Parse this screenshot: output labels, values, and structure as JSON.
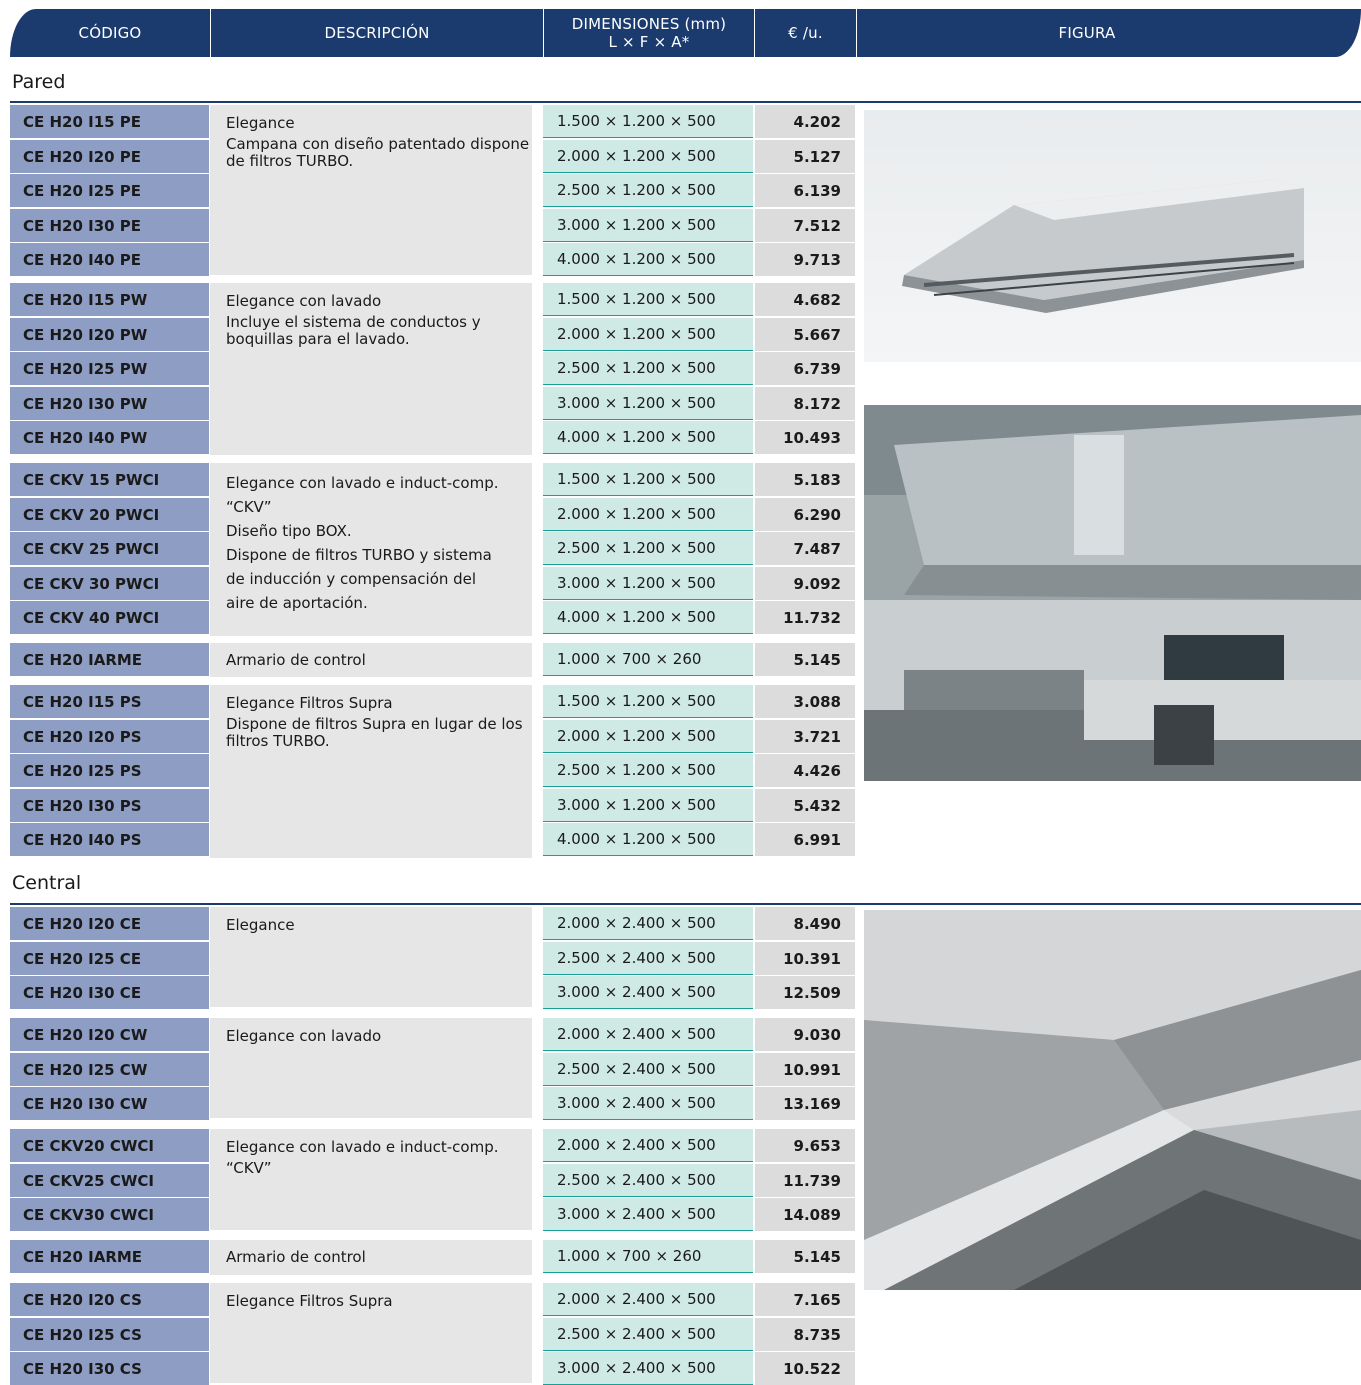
{
  "header": {
    "cols": [
      "CÓDIGO",
      "DESCRIPCIÓN",
      "DIMENSIONES (mm)",
      "€ /u.",
      "FIGURA"
    ],
    "dim_sub": "L × F × A*"
  },
  "sections": {
    "pared": {
      "title": "Pared",
      "groups": [
        {
          "name": "Elegance",
          "note": "Campana con diseño patentado dispone de filtros TURBO.",
          "rows": [
            {
              "code": "CE H20 I15 PE",
              "dim": "1.500 × 1.200 × 500",
              "price": "4.202"
            },
            {
              "code": "CE H20 I20 PE",
              "dim": "2.000 × 1.200 × 500",
              "price": "5.127"
            },
            {
              "code": "CE H20 I25 PE",
              "dim": "2.500 × 1.200 × 500",
              "price": "6.139"
            },
            {
              "code": "CE H20 I30 PE",
              "dim": "3.000 × 1.200 × 500",
              "price": "7.512"
            },
            {
              "code": "CE H20 I40 PE",
              "dim": "4.000 × 1.200 × 500",
              "price": "9.713"
            }
          ]
        },
        {
          "name": "Elegance con lavado",
          "note": "Incluye el sistema de conductos y boquillas para el lavado.",
          "rows": [
            {
              "code": "CE H20 I15 PW",
              "dim": "1.500 × 1.200 × 500",
              "price": "4.682"
            },
            {
              "code": "CE H20 I20 PW",
              "dim": "2.000 × 1.200 × 500",
              "price": "5.667"
            },
            {
              "code": "CE H20 I25 PW",
              "dim": "2.500 × 1.200 × 500",
              "price": "6.739"
            },
            {
              "code": "CE H20 I30 PW",
              "dim": "3.000 × 1.200 × 500",
              "price": "8.172"
            },
            {
              "code": "CE H20 I40 PW",
              "dim": "4.000 × 1.200 × 500",
              "price": "10.493"
            }
          ]
        },
        {
          "lines": [
            "Elegance con lavado e induct-comp.",
            "“CKV”",
            "Diseño tipo BOX.",
            "Dispone de filtros TURBO y sistema",
            "de inducción y compensación del",
            "aire de aportación."
          ],
          "rows": [
            {
              "code": "CE CKV 15 PWCI",
              "dim": "1.500 × 1.200 × 500",
              "price": "5.183"
            },
            {
              "code": "CE CKV 20 PWCI",
              "dim": "2.000 × 1.200 × 500",
              "price": "6.290"
            },
            {
              "code": "CE CKV 25 PWCI",
              "dim": "2.500 × 1.200 × 500",
              "price": "7.487"
            },
            {
              "code": "CE CKV 30 PWCI",
              "dim": "3.000 × 1.200 × 500",
              "price": "9.092"
            },
            {
              "code": "CE CKV 40 PWCI",
              "dim": "4.000 × 1.200 × 500",
              "price": "11.732"
            }
          ]
        },
        {
          "name": "Armario de control",
          "rows": [
            {
              "code": "CE H20 IARME",
              "dim": "1.000 × 700 × 260",
              "price": "5.145"
            }
          ]
        },
        {
          "name": "Elegance Filtros Supra",
          "note": "Dispone de filtros Supra en lugar de los filtros TURBO.",
          "rows": [
            {
              "code": "CE H20 I15 PS",
              "dim": "1.500 × 1.200 × 500",
              "price": "3.088"
            },
            {
              "code": "CE H20 I20 PS",
              "dim": "2.000 × 1.200 × 500",
              "price": "3.721"
            },
            {
              "code": "CE H20 I25 PS",
              "dim": "2.500 × 1.200 × 500",
              "price": "4.426"
            },
            {
              "code": "CE H20 I30 PS",
              "dim": "3.000 × 1.200 × 500",
              "price": "5.432"
            },
            {
              "code": "CE H20 I40 PS",
              "dim": "4.000 × 1.200 × 500",
              "price": "6.991"
            }
          ]
        }
      ]
    },
    "central": {
      "title": "Central",
      "groups": [
        {
          "name": "Elegance",
          "rows": [
            {
              "code": "CE H20 I20 CE",
              "dim": "2.000 × 2.400 × 500",
              "price": "8.490"
            },
            {
              "code": "CE H20 I25 CE",
              "dim": "2.500 × 2.400 × 500",
              "price": "10.391"
            },
            {
              "code": "CE H20 I30 CE",
              "dim": "3.000 × 2.400 × 500",
              "price": "12.509"
            }
          ]
        },
        {
          "name": "Elegance con lavado",
          "rows": [
            {
              "code": "CE H20 I20 CW",
              "dim": "2.000 × 2.400 × 500",
              "price": "9.030"
            },
            {
              "code": "CE H20 I25 CW",
              "dim": "2.500 × 2.400 × 500",
              "price": "10.991"
            },
            {
              "code": "CE H20 I30 CW",
              "dim": "3.000 × 2.400 × 500",
              "price": "13.169"
            }
          ]
        },
        {
          "name": "Elegance con lavado e induct-comp.",
          "note": "“CKV”",
          "rows": [
            {
              "code": "CE CKV20 CWCI",
              "dim": "2.000 × 2.400 × 500",
              "price": "9.653"
            },
            {
              "code": "CE CKV25 CWCI",
              "dim": "2.500 × 2.400 × 500",
              "price": "11.739"
            },
            {
              "code": "CE CKV30 CWCI",
              "dim": "3.000 × 2.400 × 500",
              "price": "14.089"
            }
          ]
        },
        {
          "name": "Armario de control",
          "rows": [
            {
              "code": "CE H20 IARME",
              "dim": "1.000 × 700 × 260",
              "price": "5.145"
            }
          ]
        },
        {
          "name": "Elegance Filtros Supra",
          "rows": [
            {
              "code": "CE H20 I20 CS",
              "dim": "2.000 × 2.400 × 500",
              "price": "7.165"
            },
            {
              "code": "CE H20 I25 CS",
              "dim": "2.500 × 2.400 × 500",
              "price": "8.735"
            },
            {
              "code": "CE H20 I30 CS",
              "dim": "3.000 × 2.400 × 500",
              "price": "10.522"
            }
          ]
        }
      ]
    }
  },
  "colors": {
    "header_bg": "#1b3b6f",
    "code_bg": "#8e9dc3",
    "dim_bg": "#cfe9e4",
    "dim_rule": "#16a097",
    "desc_bg": "#e6e6e6",
    "price_bg": "#dcdcdc"
  },
  "figures": [
    "wall-hood-photo",
    "kitchen-hood-photo",
    "central-hood-detail-photo"
  ]
}
